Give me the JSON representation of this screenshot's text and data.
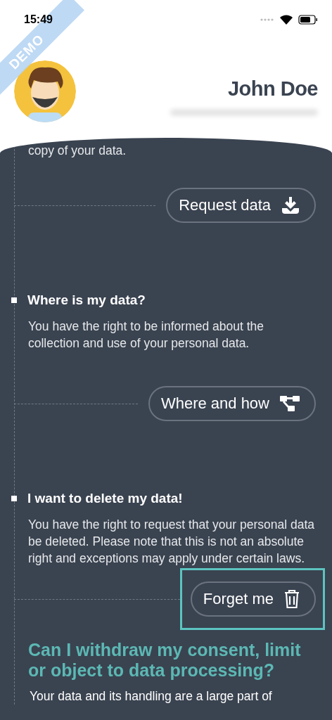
{
  "status_bar": {
    "time": "15:49"
  },
  "ribbon": {
    "label": "DEMO"
  },
  "profile": {
    "name": "John Doe"
  },
  "sections": [
    {
      "kind": "intro",
      "text": "copy of your data.",
      "button": {
        "label": "Request data",
        "highlighted": false
      }
    },
    {
      "kind": "item",
      "title": "Where is my data?",
      "text": "You have the right to be informed about the collection and use of your personal data.",
      "button": {
        "label": "Where and how",
        "highlighted": false
      }
    },
    {
      "kind": "item",
      "title": "I want to delete my data!",
      "text": "You have the right to request that your personal data be deleted. Please note that this is not an absolute right and exceptions may apply under certain laws.",
      "button": {
        "label": "Forget me",
        "highlighted": true
      }
    },
    {
      "kind": "heading",
      "title": "Can I withdraw my consent, limit or object to data processing?",
      "text": "Your data and its handling are a large part of"
    }
  ]
}
